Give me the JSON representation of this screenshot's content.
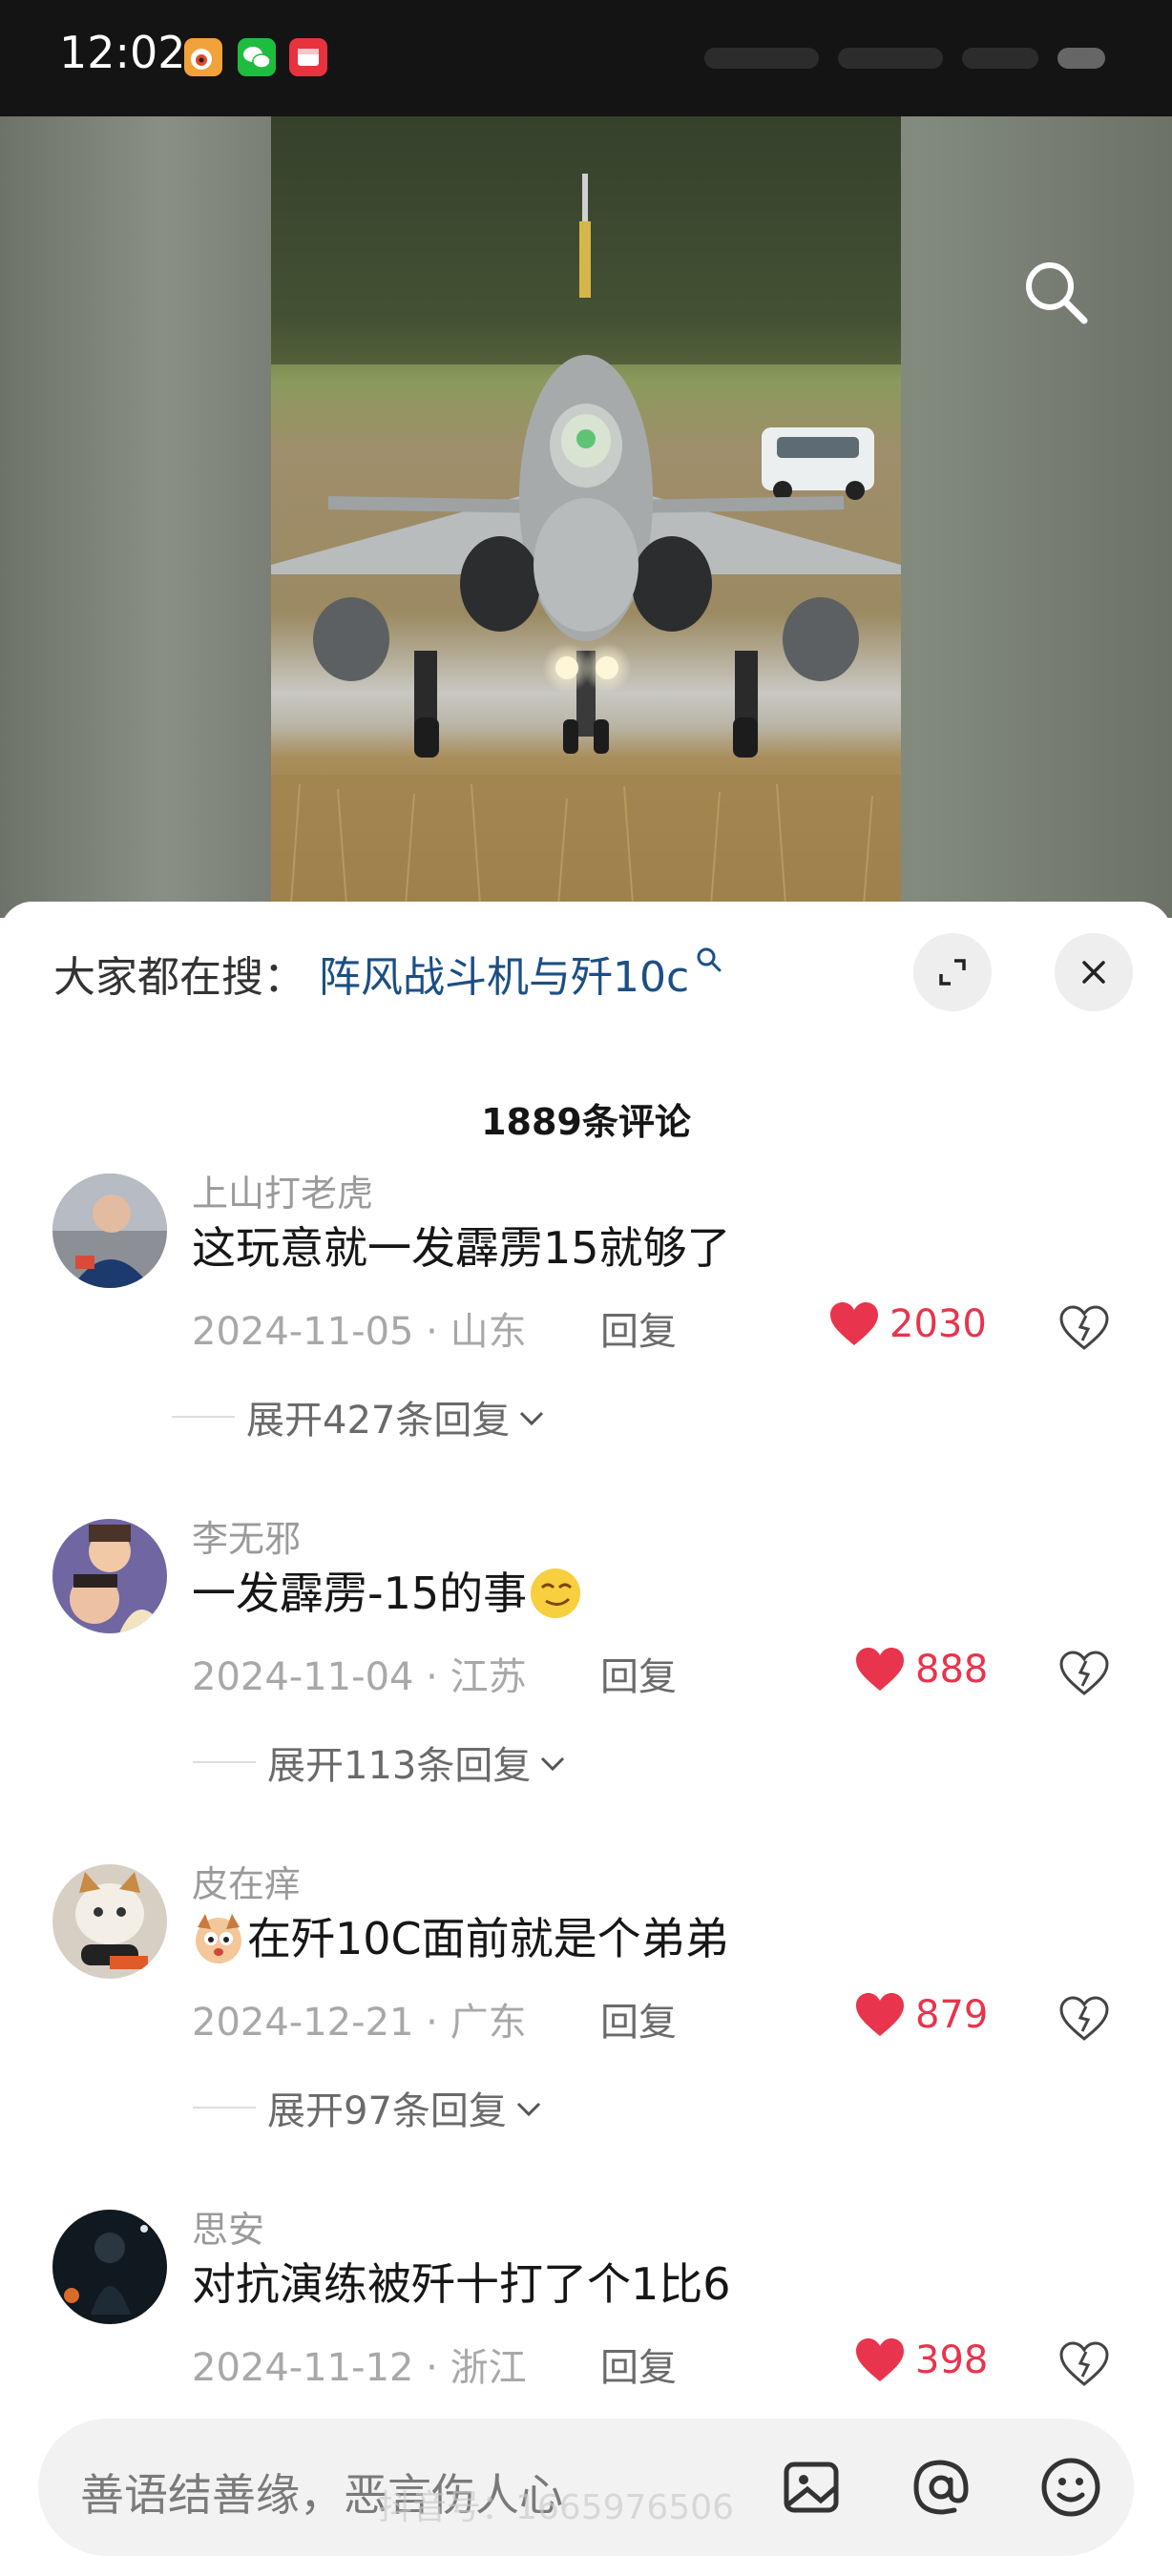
{
  "status_bar": {
    "time": "12:02",
    "app_icons": [
      "weibo-icon",
      "wechat-icon",
      "red-app-icon"
    ]
  },
  "video": {
    "search_icon": "search-icon"
  },
  "hot_search": {
    "prefix": "大家都在搜：",
    "term": "阵风战斗机与歼10c"
  },
  "comments_header": {
    "count_label": "1889条评论"
  },
  "comments": [
    {
      "username": "上山打老虎",
      "text": "这玩意就一发霹雳15就够了",
      "date": "2024-11-05",
      "location": "山东",
      "reply_label": "回复",
      "likes": "2030",
      "expand_label": "展开427条回复"
    },
    {
      "username": "李无邪",
      "text": "一发霹雳-15的事",
      "emoji_after": "smirk-emoji",
      "date": "2024-11-04",
      "location": "江苏",
      "reply_label": "回复",
      "likes": "888",
      "expand_label": "展开113条回复"
    },
    {
      "username": "皮在痒",
      "emoji_before": "dog-face-emoji",
      "text": "在歼10C面前就是个弟弟",
      "date": "2024-12-21",
      "location": "广东",
      "reply_label": "回复",
      "likes": "879",
      "expand_label": "展开97条回复"
    },
    {
      "username": "思安",
      "text": "对抗演练被歼十打了个1比6",
      "date": "2024-11-12",
      "location": "浙江",
      "reply_label": "回复",
      "likes": "398"
    }
  ],
  "input_bar": {
    "placeholder": "善语结善缘，恶言伤人心",
    "watermark": "抖音号：1665976506",
    "icons": [
      "image-icon",
      "at-icon",
      "emoji-icon"
    ]
  },
  "colors": {
    "like_red": "#e8344c",
    "link_blue": "#1c4f85"
  }
}
